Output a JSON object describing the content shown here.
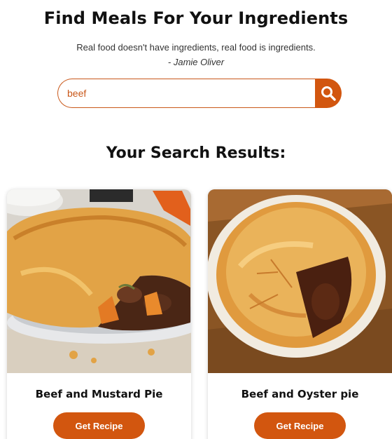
{
  "header": {
    "title": "Find Meals For Your Ingredients",
    "quote": "Real food doesn't have ingredients, real food is ingredients.",
    "author": "- Jamie Oliver"
  },
  "search": {
    "value": "beef",
    "button_icon": "search-icon"
  },
  "results": {
    "heading": "Your Search Results:",
    "items": [
      {
        "title": "Beef and Mustard Pie",
        "button_label": "Get Recipe",
        "image": "meal-photo-pie"
      },
      {
        "title": "Beef and Oyster pie",
        "button_label": "Get Recipe",
        "image": "meal-photo-pie"
      }
    ]
  },
  "colors": {
    "accent": "#d2560f",
    "text": "#111111"
  }
}
